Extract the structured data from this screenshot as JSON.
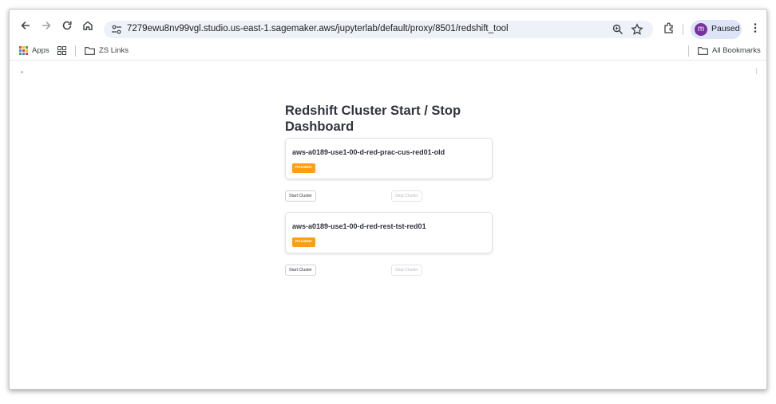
{
  "browser": {
    "url": "7279ewu8nv99vgl.studio.us-east-1.sagemaker.aws/jupyterlab/default/proxy/8501/redshift_tool",
    "profile": {
      "initial": "m",
      "label": "Paused"
    },
    "icons": [
      "back-icon",
      "forward-icon",
      "reload-icon",
      "home-icon",
      "site-info-icon",
      "zoom-icon",
      "star-icon",
      "extensions-icon",
      "menu-icon"
    ]
  },
  "bookmarks": {
    "apps_label": "Apps",
    "folder_label": "ZS Links",
    "all_label": "All Bookmarks"
  },
  "dashboard": {
    "title": "Redshift Cluster Start / Stop Dashboard",
    "clusters": [
      {
        "name": "aws-a0189-use1-00-d-red-prac-cus-red01-old",
        "status": "PAUSED",
        "start_label": "Start Cluster",
        "stop_label": "Stop Cluster"
      },
      {
        "name": "aws-a0189-use1-00-d-red-rest-tst-red01",
        "status": "PAUSED",
        "start_label": "Start Cluster",
        "stop_label": "Stop Cluster"
      }
    ],
    "badge_color": "#ff9f10"
  }
}
